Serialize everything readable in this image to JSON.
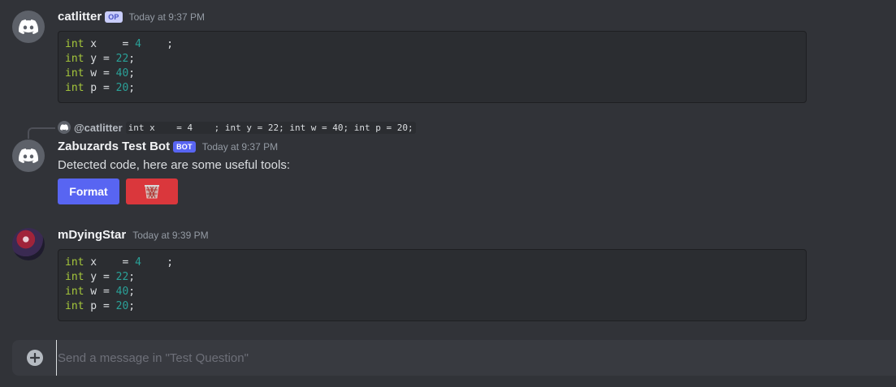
{
  "channel": {
    "name": "Test Question"
  },
  "messages": [
    {
      "author": "catlitter",
      "tag": "OP",
      "timestamp": "Today at 9:37 PM",
      "code": [
        {
          "kw": "int",
          "rest": " x    = ",
          "num": "4",
          "tail": "    ;"
        },
        {
          "kw": "int",
          "rest": " y = ",
          "num": "22",
          "tail": ";"
        },
        {
          "kw": "int",
          "rest": " w = ",
          "num": "40",
          "tail": ";"
        },
        {
          "kw": "int",
          "rest": " p = ",
          "num": "20",
          "tail": ";"
        }
      ]
    },
    {
      "author": "Zabuzards Test Bot",
      "tag": "BOT",
      "timestamp": "Today at 9:37 PM",
      "reply": {
        "to": "@catlitter",
        "snippet": "int x    = 4    ; int y = 22; int w = 40; int p = 20;"
      },
      "text": "Detected code, here are some useful tools:",
      "buttons": {
        "format_label": "Format",
        "delete_icon": "wastebasket-icon"
      }
    },
    {
      "author": "mDyingStar",
      "timestamp": "Today at 9:39 PM",
      "code": [
        {
          "kw": "int",
          "rest": " x    = ",
          "num": "4",
          "tail": "    ;"
        },
        {
          "kw": "int",
          "rest": " y = ",
          "num": "22",
          "tail": ";"
        },
        {
          "kw": "int",
          "rest": " w = ",
          "num": "40",
          "tail": ";"
        },
        {
          "kw": "int",
          "rest": " p = ",
          "num": "20",
          "tail": ";"
        }
      ]
    }
  ],
  "composer": {
    "placeholder": "Send a message in \"Test Question\"",
    "add_icon": "plus-circle-icon"
  },
  "colors": {
    "background": "#313338",
    "blurple": "#5865f2",
    "danger": "#da373c",
    "keyword": "#a6c83b",
    "number": "#2aa198"
  }
}
